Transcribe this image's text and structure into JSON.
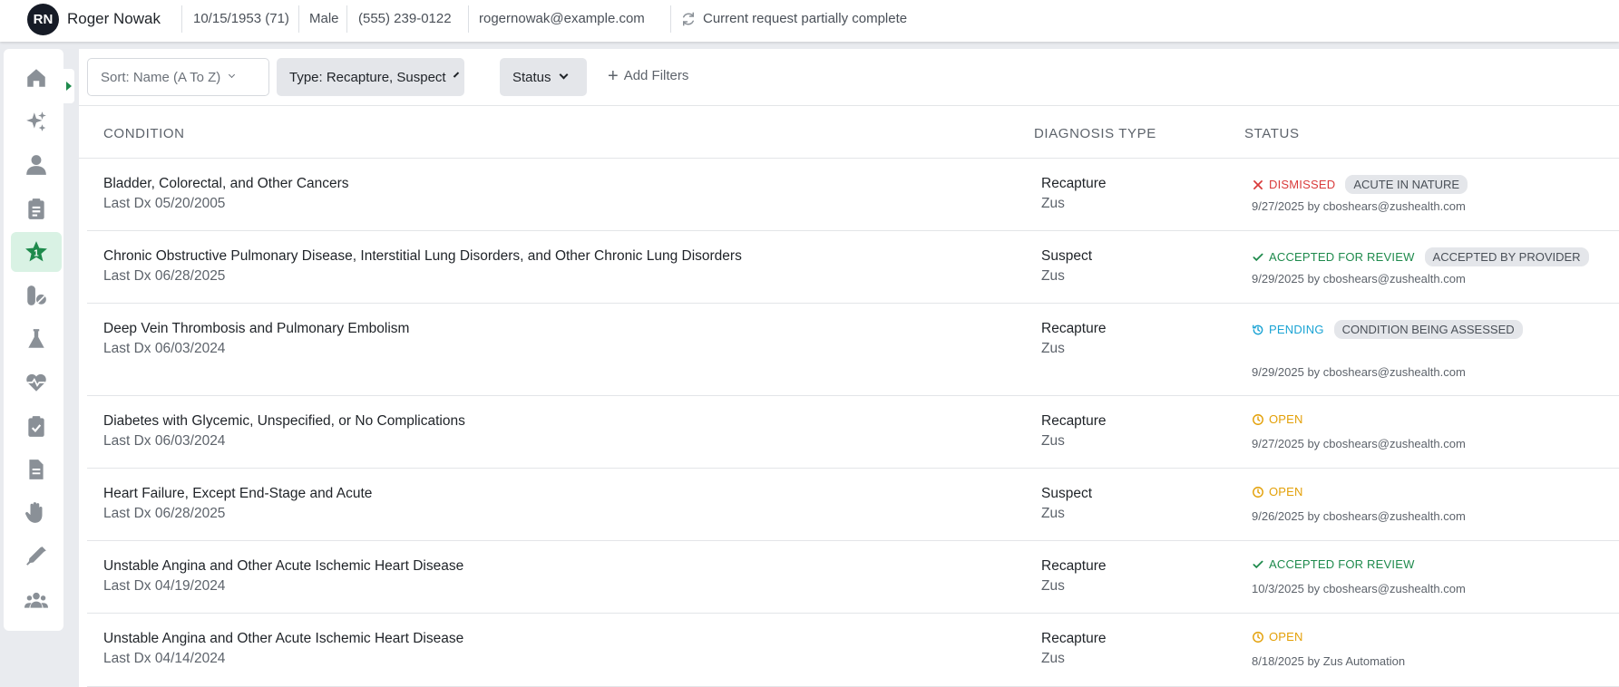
{
  "patient": {
    "initials": "RN",
    "name": "Roger Nowak",
    "dob": "10/15/1953 (71)",
    "sex": "Male",
    "phone": "(555) 239-0122",
    "email": "rogernowak@example.com",
    "request_status": "Current request partially complete"
  },
  "sidebar": {
    "icons": [
      "home-icon",
      "sparkles-icon",
      "person-icon",
      "clipboard-list-icon",
      "star-badge-icon",
      "pills-icon",
      "flask-icon",
      "heartbeat-icon",
      "clipboard-check-icon",
      "document-icon",
      "hand-icon",
      "syringe-icon",
      "users-icon"
    ],
    "active_index": 4
  },
  "filters": {
    "sort": "Sort: Name (A To Z)",
    "type": "Type: Recapture, Suspect",
    "status": "Status",
    "add": "Add Filters"
  },
  "table": {
    "headers": {
      "condition": "CONDITION",
      "diagnosis_type": "DIAGNOSIS TYPE",
      "status": "STATUS"
    },
    "rows": [
      {
        "condition": "Bladder, Colorectal, and Other Cancers",
        "last_dx": "Last Dx 05/20/2005",
        "dx_type": "Recapture",
        "source": "Zus",
        "status": "DISMISSED",
        "status_kind": "dismissed",
        "badge": "ACUTE IN NATURE",
        "meta": "9/27/2025 by cboshears@zushealth.com"
      },
      {
        "condition": "Chronic Obstructive Pulmonary Disease, Interstitial Lung Disorders, and Other Chronic Lung Disorders",
        "last_dx": "Last Dx 06/28/2025",
        "dx_type": "Suspect",
        "source": "Zus",
        "status": "ACCEPTED FOR REVIEW",
        "status_kind": "accepted",
        "badge": "ACCEPTED BY PROVIDER",
        "meta": "9/29/2025 by cboshears@zushealth.com"
      },
      {
        "condition": "Deep Vein Thrombosis and Pulmonary Embolism",
        "last_dx": "Last Dx 06/03/2024",
        "dx_type": "Recapture",
        "source": "Zus",
        "status": "PENDING",
        "status_kind": "pending",
        "badge": "CONDITION BEING ASSESSED",
        "meta": "9/29/2025 by cboshears@zushealth.com"
      },
      {
        "condition": "Diabetes with Glycemic, Unspecified, or No Complications",
        "last_dx": "Last Dx 06/03/2024",
        "dx_type": "Recapture",
        "source": "Zus",
        "status": "OPEN",
        "status_kind": "open",
        "badge": "",
        "meta": "9/27/2025 by cboshears@zushealth.com"
      },
      {
        "condition": "Heart Failure, Except End-Stage and Acute",
        "last_dx": "Last Dx 06/28/2025",
        "dx_type": "Suspect",
        "source": "Zus",
        "status": "OPEN",
        "status_kind": "open",
        "badge": "",
        "meta": "9/26/2025 by cboshears@zushealth.com"
      },
      {
        "condition": "Unstable Angina and Other Acute Ischemic Heart Disease",
        "last_dx": "Last Dx 04/19/2024",
        "dx_type": "Recapture",
        "source": "Zus",
        "status": "ACCEPTED FOR REVIEW",
        "status_kind": "accepted",
        "badge": "",
        "meta": "10/3/2025 by cboshears@zushealth.com"
      },
      {
        "condition": "Unstable Angina and Other Acute Ischemic Heart Disease",
        "last_dx": "Last Dx 04/14/2024",
        "dx_type": "Recapture",
        "source": "Zus",
        "status": "OPEN",
        "status_kind": "open",
        "badge": "",
        "meta": "8/18/2025 by Zus Automation"
      }
    ]
  },
  "colors": {
    "dismissed": "#d93b3b",
    "accepted": "#1e8a4c",
    "pending": "#1aa3d4",
    "open": "#e3a008",
    "active_nav": "#1e8a4c",
    "nav_icon": "#8a9097"
  }
}
